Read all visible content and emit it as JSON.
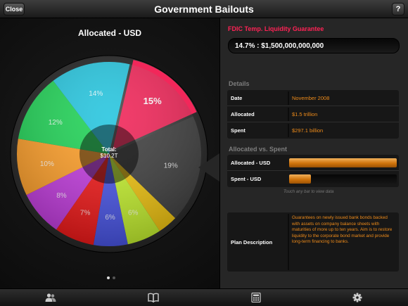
{
  "header": {
    "title": "Government Bailouts",
    "close_label": "Close",
    "help_label": "?"
  },
  "pie_panel": {
    "title": "Allocated - USD",
    "center_label": "Total:",
    "center_value": "$10.2T",
    "page_dots": 2,
    "active_dot": 0
  },
  "chart_data": {
    "type": "pie",
    "title": "Allocated - USD",
    "selected_index": 0,
    "slices": [
      {
        "label": "15%",
        "value": 14.7,
        "color": "#f2275a"
      },
      {
        "label": "19%",
        "value": 19,
        "color": "#404040"
      },
      {
        "label": "",
        "value": 3.5,
        "color": "#f2c511"
      },
      {
        "label": "6%",
        "value": 6,
        "color": "#c6f230"
      },
      {
        "label": "6%",
        "value": 6,
        "color": "#4a56e8"
      },
      {
        "label": "7%",
        "value": 7,
        "color": "#f21a1a"
      },
      {
        "label": "8%",
        "value": 8,
        "color": "#c43de0"
      },
      {
        "label": "10%",
        "value": 10,
        "color": "#ffa02a"
      },
      {
        "label": "12%",
        "value": 12,
        "color": "#22d458"
      },
      {
        "label": "14%",
        "value": 14,
        "color": "#28c6df"
      }
    ]
  },
  "detail": {
    "program_title": "FDIC Temp. Liquidity Guarantee",
    "program_value": "14.7% : $1,500,000,000,000",
    "details_heading": "Details",
    "rows": [
      {
        "label": "Date",
        "value": "November 2008"
      },
      {
        "label": "Allocated",
        "value": "$1.5 trillion"
      },
      {
        "label": "Spent",
        "value": "$297.1 billion"
      }
    ],
    "compare_heading": "Allocated vs. Spent",
    "bars": [
      {
        "label": "Allocated - USD",
        "fraction": 1.0
      },
      {
        "label": "Spent - USD",
        "fraction": 0.2
      }
    ],
    "hint": "Touch any bar to view data",
    "plan_label": "Plan Description",
    "plan_text": "Guarantees on newly issued bank bonds backed with assets on company balance sheets with maturities of more up to ten years. Aim is to restore liquidity to the corporate bond market and provide long-term financing to banks."
  },
  "tabbar": {
    "tabs": [
      {
        "name": "tab-people",
        "icon": "people-icon"
      },
      {
        "name": "tab-book",
        "icon": "book-icon"
      },
      {
        "name": "tab-calculator",
        "icon": "calculator-icon"
      },
      {
        "name": "tab-settings",
        "icon": "gear-icon"
      }
    ]
  }
}
